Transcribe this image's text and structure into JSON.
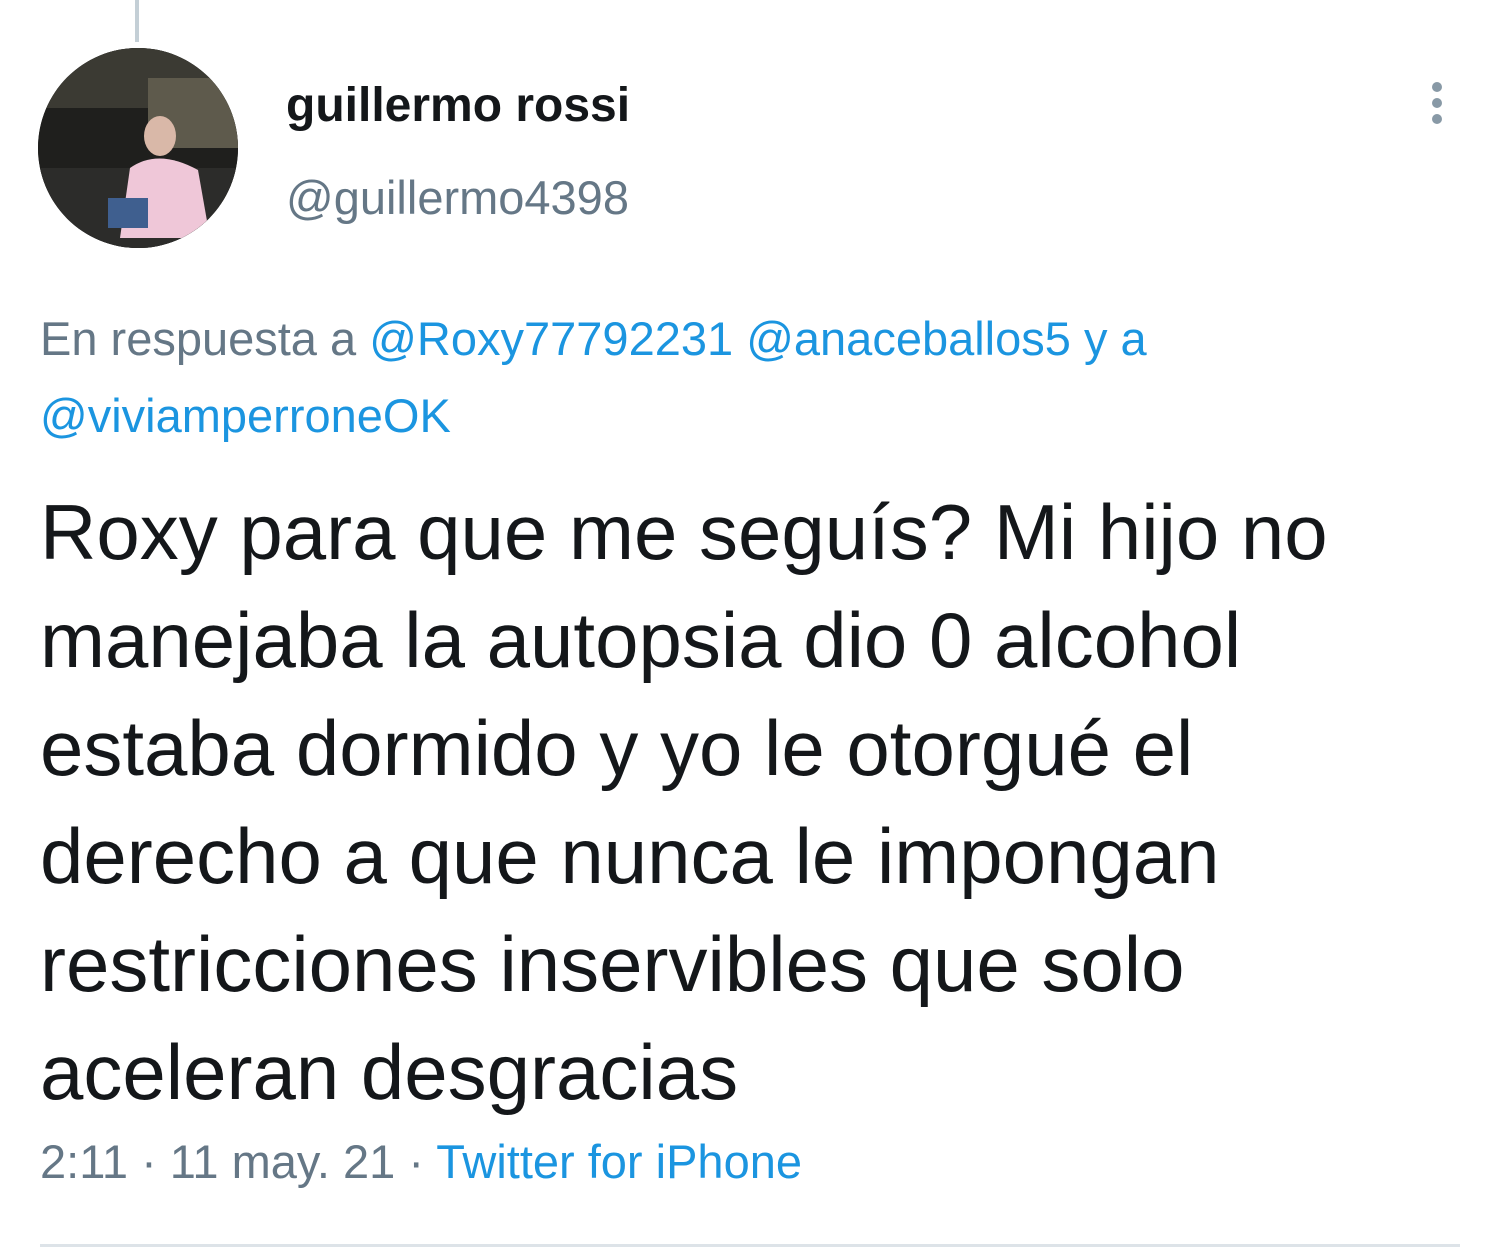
{
  "tweet": {
    "author": {
      "display_name": "guillermo rossi",
      "handle": "@guillermo4398"
    },
    "reply_context": {
      "prefix": "En respuesta a ",
      "mention_1": "@Roxy77792231",
      "mention_2": "@anaceballos5",
      "connector": "y a",
      "mention_3": "@viviamperroneOK"
    },
    "text": "Roxy para que me seguís? Mi hijo no manejaba la autopsia dio 0 alcohol estaba dormido y yo le otorgué el derecho a que nunca le impongan restricciones inservibles que solo aceleran desgracias",
    "time": "2:11",
    "separator": "·",
    "date": "11 may. 21",
    "source": "Twitter for iPhone"
  },
  "icons": {
    "more": "more-vertical-icon",
    "avatar": "profile-photo"
  },
  "colors": {
    "text": "#14171a",
    "secondary": "#657786",
    "link": "#1b95e0",
    "divider": "#dde3e8"
  }
}
